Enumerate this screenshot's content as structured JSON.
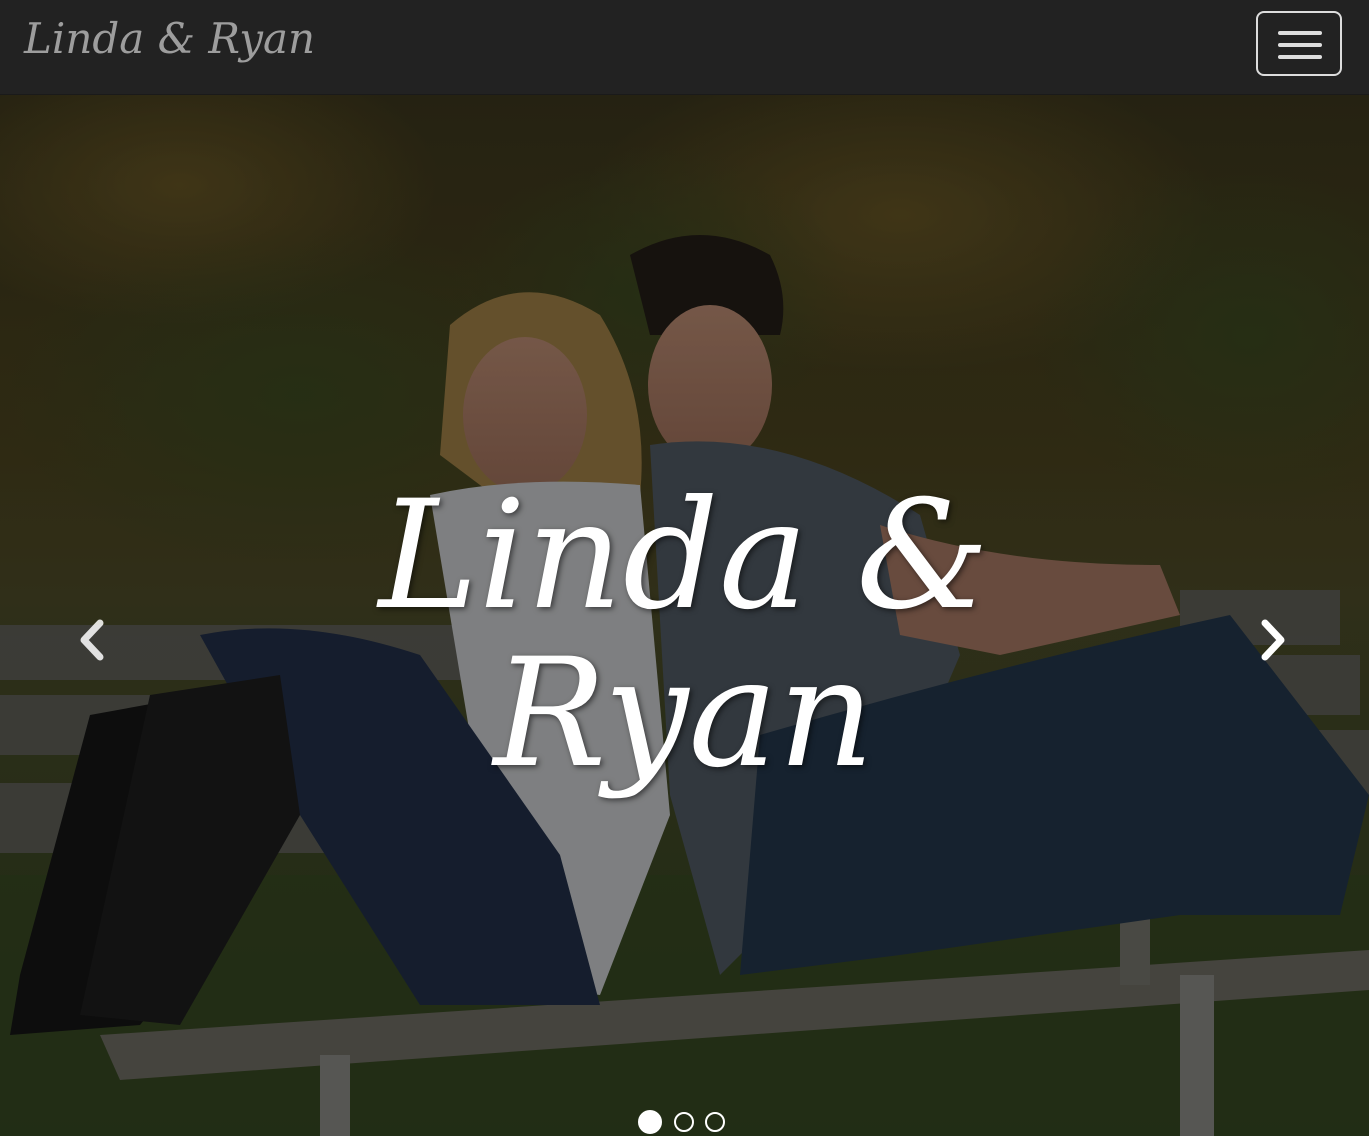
{
  "navbar": {
    "brand": "Linda & Ryan",
    "toggle_icon": "hamburger-menu-icon"
  },
  "carousel": {
    "caption_line1": "Linda &",
    "caption_line2": "Ryan",
    "prev_icon": "chevron-left-icon",
    "next_icon": "chevron-right-icon",
    "slide_count": 3,
    "active_slide": 1,
    "photo_description_icon": "couple-on-bench-photo"
  },
  "colors": {
    "navbar_bg": "#222222",
    "brand_text": "#9d9d9d",
    "toggle_border": "#dddddd",
    "caption_text": "#ffffff"
  }
}
